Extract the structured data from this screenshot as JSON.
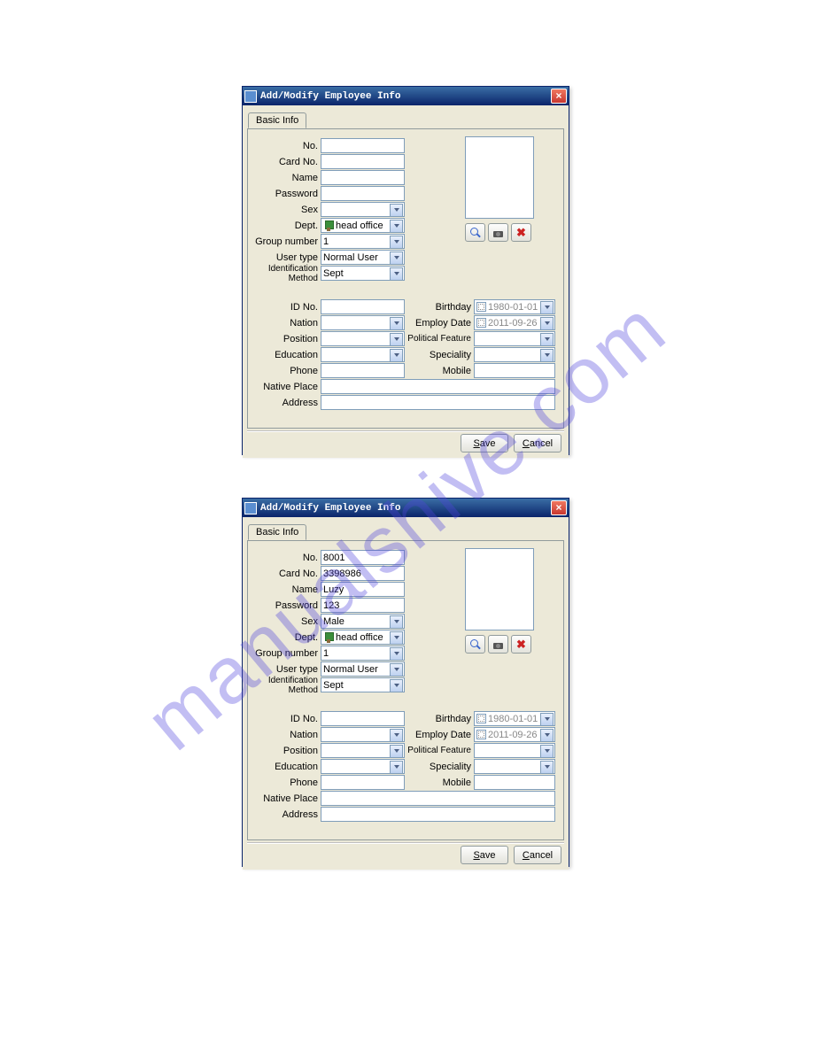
{
  "watermark": "manualshive.com",
  "window_title": "Add/Modify Employee Info",
  "tab_label": "Basic Info",
  "labels": {
    "no": "No.",
    "card_no": "Card No.",
    "name": "Name",
    "password": "Password",
    "sex": "Sex",
    "dept": "Dept.",
    "group_number": "Group number",
    "user_type": "User type",
    "identification_method": "Identification Method",
    "id_no": "ID No.",
    "nation": "Nation",
    "position": "Position",
    "education": "Education",
    "phone": "Phone",
    "native_place": "Native Place",
    "address": "Address",
    "birthday": "Birthday",
    "employ_date": "Employ Date",
    "political_feature": "Political Feature",
    "speciality": "Speciality",
    "mobile": "Mobile"
  },
  "buttons": {
    "save": "Save",
    "cancel": "Cancel"
  },
  "win1": {
    "no": "",
    "card_no": "",
    "name": "",
    "password": "",
    "sex": "",
    "dept": "head office",
    "group_number": "1",
    "user_type": "Normal User",
    "identification_method": "Sept",
    "id_no": "",
    "nation": "",
    "position": "",
    "education": "",
    "phone": "",
    "native_place": "",
    "address": "",
    "birthday": "1980-01-01",
    "employ_date": "2011-09-26",
    "political_feature": "",
    "speciality": "",
    "mobile": ""
  },
  "win2": {
    "no": "8001",
    "card_no": "3398986",
    "name": "Luzy",
    "password": "123",
    "sex": "Male",
    "dept": "head office",
    "group_number": "1",
    "user_type": "Normal User",
    "identification_method": "Sept",
    "id_no": "",
    "nation": "",
    "position": "",
    "education": "",
    "phone": "",
    "native_place": "",
    "address": "",
    "birthday": "1980-01-01",
    "employ_date": "2011-09-26",
    "political_feature": "",
    "speciality": "",
    "mobile": ""
  }
}
